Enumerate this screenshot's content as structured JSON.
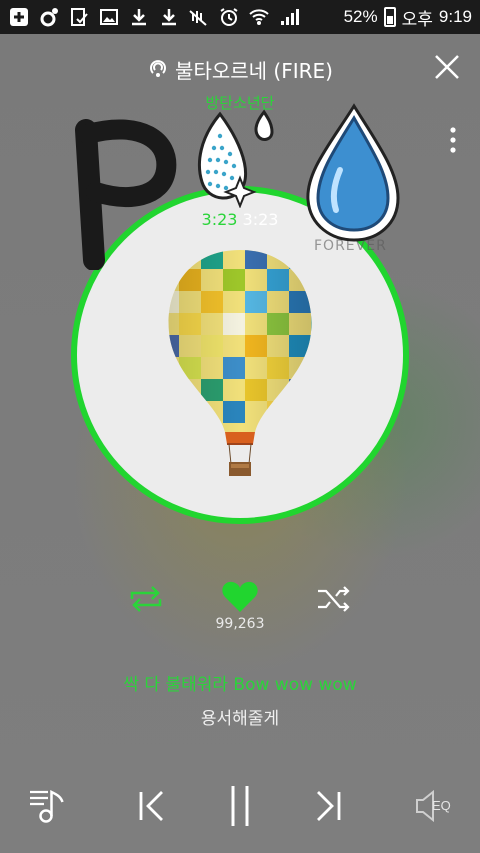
{
  "status_bar": {
    "battery": "52%",
    "ampm": "오후",
    "time": "9:19"
  },
  "player": {
    "title": "불타오르네 (FIRE)",
    "artist": "방탄소년단",
    "elapsed": "3:23",
    "duration": "3:23",
    "like_count": "99,263",
    "lyric_current": "싹 다 불태워라 Bow wow wow",
    "lyric_next": "용서해줄게",
    "eq_label": "EQ",
    "accent_color": "#21d52f"
  },
  "album_watermark": "FOREVER"
}
